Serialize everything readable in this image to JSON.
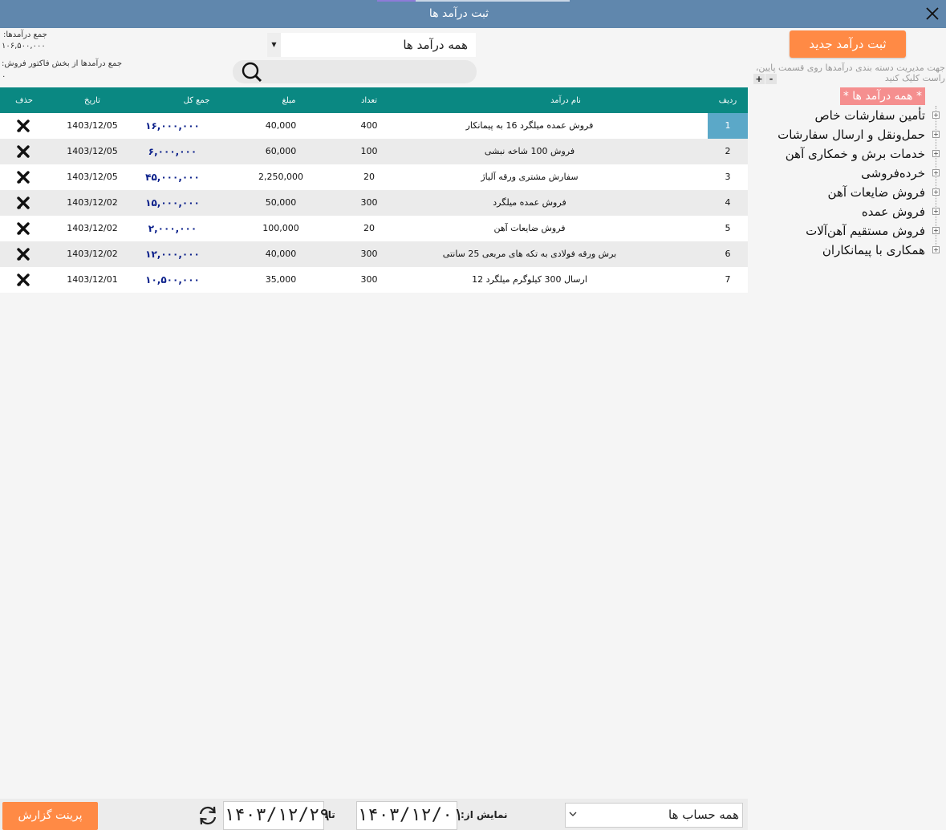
{
  "window": {
    "title": "ثبت درآمد ها"
  },
  "totals": {
    "all_label": "جمع درآمدها:",
    "all_value": "۱۰۶,۵۰۰,۰۰۰",
    "invoice_label": "جمع درآمدها از بخش فاکتور فروش:",
    "invoice_value": "۰"
  },
  "filter": {
    "selected": "همه درآمد ها"
  },
  "new_button": {
    "label": "ثبت درآمد جدید"
  },
  "tree": {
    "hint": "جهت مدیریت دسته بندی درآمدها روی قسمت پایین، راست کلیک کنید",
    "expand_all": "+",
    "collapse_all": "-",
    "root": "* همه درآمد ها *",
    "nodes": [
      "تأمین سفارشات خاص",
      "حمل‌ونقل و ارسال سفارشات",
      "خدمات برش و خمکاری آهن",
      "خرده‌فروشی",
      "فروش ضایعات آهن",
      "فروش عمده",
      "فروش مستقیم آهن‌آلات",
      "همکاری با پیمانکاران"
    ]
  },
  "table": {
    "columns": {
      "num": "ردیف",
      "title": "نام درآمد",
      "qty": "تعداد",
      "amount": "مبلغ",
      "total": "جمع کل",
      "date": "تاریخ",
      "delete": "حذف"
    },
    "rows": [
      {
        "num": "1",
        "title": "فروش عمده میلگرد 16 به پیمانکار",
        "qty": "400",
        "amount": "40,000",
        "total": "۱۶,۰۰۰,۰۰۰",
        "date": "1403/12/05"
      },
      {
        "num": "2",
        "title": "فروش 100 شاخه نبشی",
        "qty": "100",
        "amount": "60,000",
        "total": "۶,۰۰۰,۰۰۰",
        "date": "1403/12/05"
      },
      {
        "num": "3",
        "title": "سفارش مشتری ورقه آلیاژ",
        "qty": "20",
        "amount": "2,250,000",
        "total": "۴۵,۰۰۰,۰۰۰",
        "date": "1403/12/05"
      },
      {
        "num": "4",
        "title": "فروش عمده میلگرد",
        "qty": "300",
        "amount": "50,000",
        "total": "۱۵,۰۰۰,۰۰۰",
        "date": "1403/12/02"
      },
      {
        "num": "5",
        "title": "فروش ضایعات آهن",
        "qty": "20",
        "amount": "100,000",
        "total": "۲,۰۰۰,۰۰۰",
        "date": "1403/12/02"
      },
      {
        "num": "6",
        "title": "برش ورقه فولادی به تکه های مربعی 25 سانتی",
        "qty": "300",
        "amount": "40,000",
        "total": "۱۲,۰۰۰,۰۰۰",
        "date": "1403/12/02"
      },
      {
        "num": "7",
        "title": "ارسال 300 کیلوگرم میلگرد 12",
        "qty": "300",
        "amount": "35,000",
        "total": "۱۰,۵۰۰,۰۰۰",
        "date": "1403/12/01"
      }
    ]
  },
  "footer": {
    "print_label": "پرینت گزارش",
    "to_label": "تا:",
    "to_date": "۱۴۰۳/۱۲/۲۹",
    "from_label": "نمایش از:",
    "from_date": "۱۴۰۳/۱۲/۰۱",
    "account": "همه حساب ها"
  }
}
